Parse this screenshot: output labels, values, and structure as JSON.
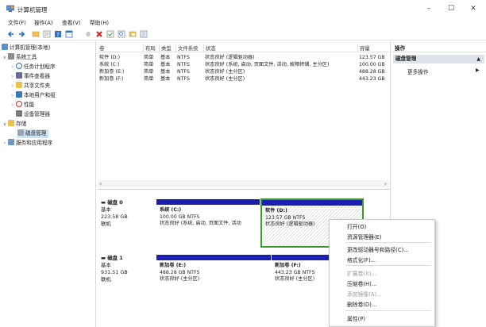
{
  "window": {
    "title": "计算机管理",
    "controls": [
      "–",
      "☐",
      "✕"
    ]
  },
  "menu": [
    "文件(F)",
    "操作(A)",
    "查看(V)",
    "帮助(H)"
  ],
  "toolbar_icons": [
    "back-icon",
    "forward-icon",
    "folder-icon",
    "properties-icon",
    "help-icon",
    "view-icon",
    "disconnect-icon",
    "delete-icon",
    "check-icon",
    "search-icon",
    "folder-open-icon",
    "list-icon"
  ],
  "tree": [
    {
      "label": "计算机管理(本地)",
      "level": 0,
      "chev": "",
      "icon": "computer-icon"
    },
    {
      "label": "系统工具",
      "level": 0,
      "chev": "∨",
      "icon": "tools-icon"
    },
    {
      "label": "任务计划程序",
      "level": 1,
      "chev": "›",
      "icon": "clock-icon"
    },
    {
      "label": "事件查看器",
      "level": 1,
      "chev": "›",
      "icon": "event-icon"
    },
    {
      "label": "共享文件夹",
      "level": 1,
      "chev": "›",
      "icon": "shared-folder-icon"
    },
    {
      "label": "本地用户和组",
      "level": 1,
      "chev": "›",
      "icon": "users-icon"
    },
    {
      "label": "性能",
      "level": 1,
      "chev": "›",
      "icon": "performance-icon"
    },
    {
      "label": "设备管理器",
      "level": 1,
      "chev": "",
      "icon": "device-icon"
    },
    {
      "label": "存储",
      "level": 0,
      "chev": "∨",
      "icon": "storage-icon"
    },
    {
      "label": "磁盘管理",
      "level": 1,
      "chev": "",
      "icon": "disk-icon"
    },
    {
      "label": "服务和应用程序",
      "level": 0,
      "chev": "›",
      "icon": "services-icon"
    }
  ],
  "volume_list": {
    "headers": [
      "卷",
      "布局",
      "类型",
      "文件系统",
      "状态",
      "容量"
    ],
    "rows": [
      [
        "软件 (D:)",
        "简单",
        "基本",
        "NTFS",
        "状态良好 (逻辑驱动器)",
        "123.57 GB"
      ],
      [
        "系统 (C:)",
        "简单",
        "基本",
        "NTFS",
        "状态良好 (系统, 启动, 页面文件, 活动, 故障转储, 主分区)",
        "100.00 GB"
      ],
      [
        "新加卷 (E:)",
        "简单",
        "基本",
        "NTFS",
        "状态良好 (主分区)",
        "488.28 GB"
      ],
      [
        "新加卷 (F:)",
        "简单",
        "基本",
        "NTFS",
        "状态良好 (主分区)",
        "443.23 GB"
      ]
    ],
    "scroll_left": "‹",
    "scroll_right": "›"
  },
  "disks": [
    {
      "name": "磁盘 0",
      "type": "基本",
      "size": "223.58 GB",
      "status": "联机",
      "partitions": [
        {
          "name": "系统 (C:)",
          "size": "100.00 GB NTFS",
          "status": "状态良好 (系统, 启动, 页面文件, 活动"
        },
        {
          "name": "软件 (D:)",
          "size": "123.57 GB NTFS",
          "status": "状态良好 (逻辑驱动器)"
        }
      ]
    },
    {
      "name": "磁盘 1",
      "type": "基本",
      "size": "931.51 GB",
      "status": "联机",
      "partitions": [
        {
          "name": "新加卷 (E:)",
          "size": "488.28 GB NTFS",
          "status": "状态良好 (主分区)"
        },
        {
          "name": "新加卷 (F:)",
          "size": "443.23 GB NTFS",
          "status": "状态良好 (主分区)"
        }
      ]
    }
  ],
  "actions": {
    "header": "操作",
    "section": "磁盘管理",
    "more": "更多操作"
  },
  "context_menu": [
    {
      "label": "打开(O)",
      "enabled": true
    },
    {
      "label": "资源管理器(E)",
      "enabled": true
    },
    {
      "sep": true
    },
    {
      "label": "更改驱动器号和路径(C)...",
      "enabled": true
    },
    {
      "label": "格式化(F)...",
      "enabled": true
    },
    {
      "sep": true
    },
    {
      "label": "扩展卷(X)...",
      "enabled": false
    },
    {
      "label": "压缩卷(H)...",
      "enabled": true
    },
    {
      "label": "添加镜像(A)...",
      "enabled": false
    },
    {
      "label": "删除卷(D)...",
      "enabled": true
    },
    {
      "sep": true
    },
    {
      "label": "属性(P)",
      "enabled": true
    }
  ],
  "colors": {
    "partition_bar": "#1c1fad",
    "selected_partition_border": "#3a9a2a",
    "selection": "#cce4f7"
  }
}
